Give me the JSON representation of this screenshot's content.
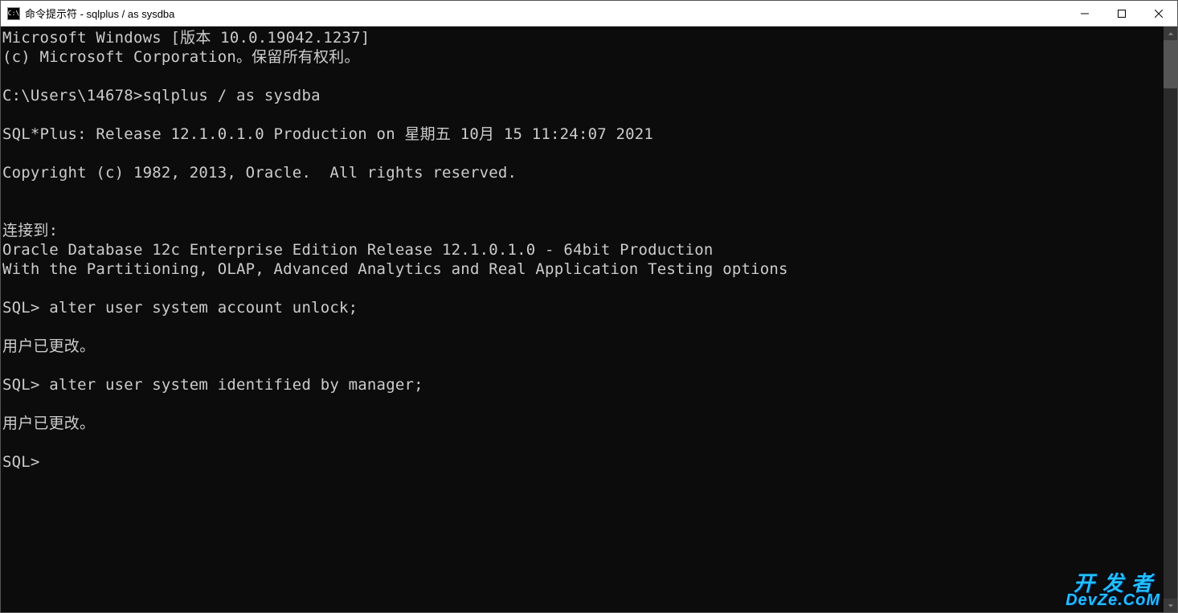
{
  "titlebar": {
    "icon_text": "C:\\",
    "title": "命令提示符 - sqlplus  / as sysdba"
  },
  "terminal": {
    "lines": [
      "Microsoft Windows [版本 10.0.19042.1237]",
      "(c) Microsoft Corporation。保留所有权利。",
      "",
      "C:\\Users\\14678>sqlplus / as sysdba",
      "",
      "SQL*Plus: Release 12.1.0.1.0 Production on 星期五 10月 15 11:24:07 2021",
      "",
      "Copyright (c) 1982, 2013, Oracle.  All rights reserved.",
      "",
      "",
      "连接到:",
      "Oracle Database 12c Enterprise Edition Release 12.1.0.1.0 - 64bit Production",
      "With the Partitioning, OLAP, Advanced Analytics and Real Application Testing options",
      "",
      "SQL> alter user system account unlock;",
      "",
      "用户已更改。",
      "",
      "SQL> alter user system identified by manager;",
      "",
      "用户已更改。",
      "",
      "SQL>"
    ]
  },
  "watermark": {
    "line1": "开发者",
    "line2": "DevZe.CoM"
  }
}
